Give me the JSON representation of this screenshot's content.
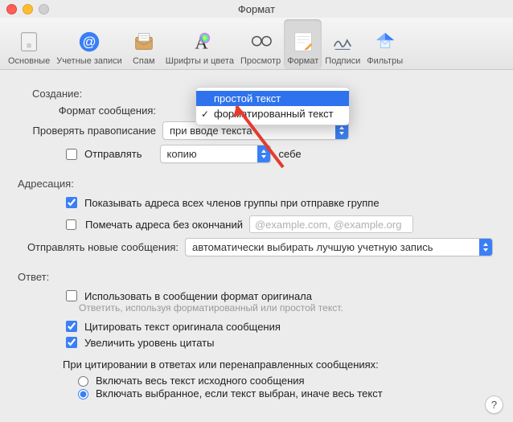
{
  "window_title": "Формат",
  "toolbar": [
    {
      "label": "Основные"
    },
    {
      "label": "Учетные записи"
    },
    {
      "label": "Спам"
    },
    {
      "label": "Шрифты и цвета"
    },
    {
      "label": "Просмотр"
    },
    {
      "label": "Формат"
    },
    {
      "label": "Подписи"
    },
    {
      "label": "Фильтры"
    }
  ],
  "sections": {
    "creation": "Создание:",
    "addressing": "Адресация:",
    "reply": "Ответ:"
  },
  "creation": {
    "format_label": "Формат сообщения:",
    "spell_label": "Проверять правописание",
    "spell_value": "при вводе текста",
    "send_label": "Отправлять",
    "send_value": "копию",
    "send_tail": "себе"
  },
  "dropdown": {
    "plain": "простой текст",
    "rich": "форматированный текст"
  },
  "addressing": {
    "group": "Показывать адреса всех членов группы при отправке группе",
    "mark": "Помечать адреса без окончаний",
    "mark_placeholder": "@example.com, @example.org",
    "sendfrom_label": "Отправлять новые сообщения:",
    "sendfrom_value": "автоматически выбирать лучшую учетную запись"
  },
  "reply": {
    "orig": "Использовать в сообщении формат оригинала",
    "orig_sub": "Ответить, используя форматированный или простой текст.",
    "quote": "Цитировать текст оригинала сообщения",
    "level": "Увеличить уровень цитаты",
    "cite_head": "При цитировании в ответах или перенаправленных сообщениях:",
    "r1": "Включать весь текст исходного сообщения",
    "r2": "Включать выбранное, если текст выбран, иначе весь текст"
  },
  "help": "?"
}
